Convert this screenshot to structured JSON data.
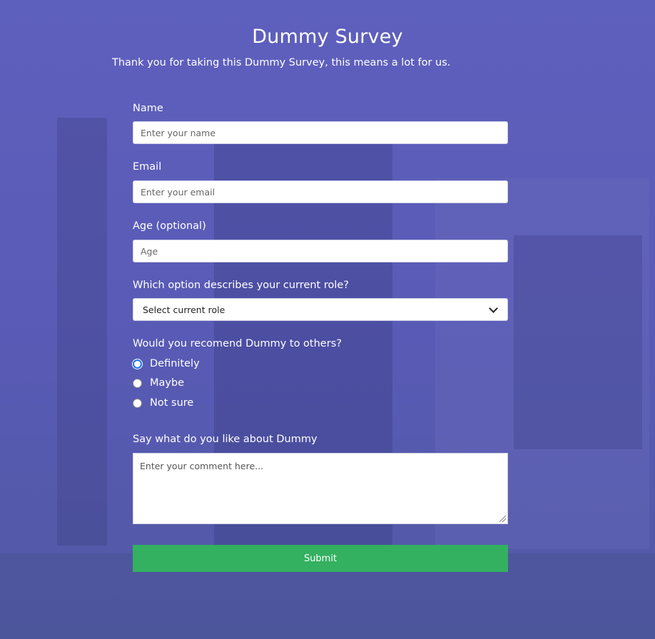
{
  "header": {
    "title": "Dummy Survey",
    "subtitle": "Thank you for taking this Dummy Survey, this means a lot for us."
  },
  "form": {
    "name": {
      "label": "Name",
      "placeholder": "Enter your name",
      "value": ""
    },
    "email": {
      "label": "Email",
      "placeholder": "Enter your email",
      "value": ""
    },
    "age": {
      "label": "Age (optional)",
      "placeholder": "Age",
      "value": ""
    },
    "role": {
      "label": "Which option describes your current role?",
      "selected": "Select current role"
    },
    "recommend": {
      "label": "Would you recomend Dummy to others?",
      "options": [
        "Definitely",
        "Maybe",
        "Not sure"
      ],
      "focused": "Definitely"
    },
    "comment": {
      "label": "Say what do you like about Dummy",
      "placeholder": "Enter your comment here..."
    },
    "submit_label": "Submit"
  },
  "colors": {
    "overlay": "#5a5cb8",
    "submit": "#33b060",
    "radio_focus": "#1a73e8"
  }
}
